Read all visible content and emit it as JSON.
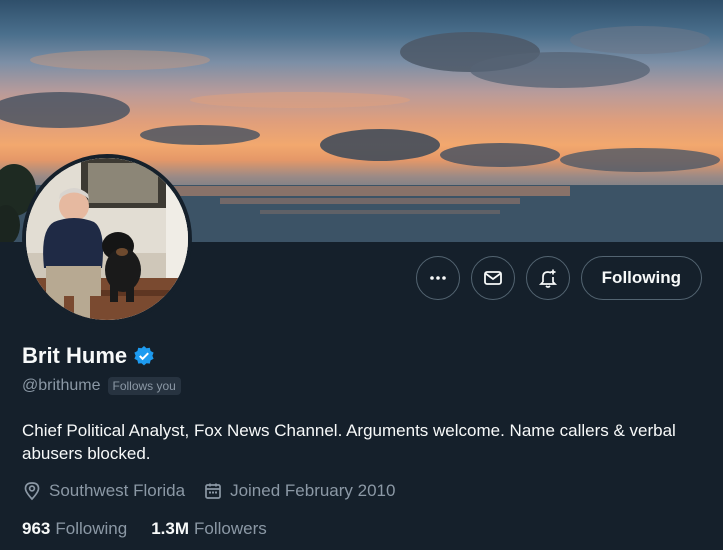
{
  "banner": {
    "description_colors": {
      "sky_top": "#2f4f6a",
      "sunset": "#f2a86e",
      "water": "#3f5466"
    }
  },
  "actions": {
    "more_icon": "more-icon",
    "message_icon": "message-icon",
    "notify_icon": "notification-bell-icon",
    "following_label": "Following"
  },
  "profile": {
    "name": "Brit Hume",
    "verified_icon": "verified-badge-icon",
    "handle": "@brithume",
    "follows_you": "Follows you",
    "bio": "Chief Political Analyst, Fox News Channel. Arguments welcome. Name callers & verbal abusers blocked.",
    "location": "Southwest Florida",
    "joined": "Joined February 2010",
    "following_count": "963",
    "following_label": "Following",
    "followers_count": "1.3M",
    "followers_label": "Followers"
  },
  "colors": {
    "background": "#15202b",
    "text": "#f7f9f9",
    "secondary_text": "#8b98a5",
    "border": "#536471",
    "verified": "#1d9bf0"
  }
}
